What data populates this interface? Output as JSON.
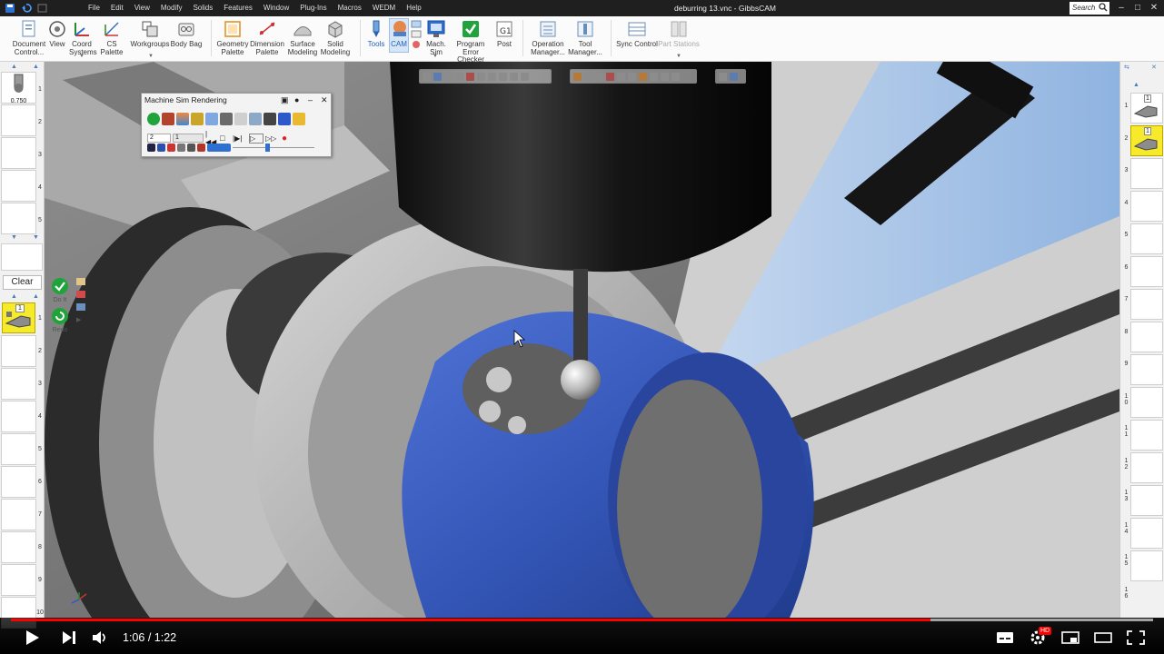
{
  "window": {
    "title": "deburring 13.vnc - GibbsCAM",
    "menus": [
      "File",
      "Edit",
      "View",
      "Modify",
      "Solids",
      "Features",
      "Window",
      "Plug-Ins",
      "Macros",
      "WEDM",
      "Help"
    ],
    "search_placeholder": "Search"
  },
  "ribbon": {
    "buttons": [
      {
        "label1": "Document",
        "label2": "Control..."
      },
      {
        "label1": "View",
        "label2": ""
      },
      {
        "label1": "Coord",
        "label2": "Systems"
      },
      {
        "label1": "CS Palette",
        "label2": ""
      },
      {
        "label1": "Workgroups",
        "label2": ""
      },
      {
        "label1": "Body Bag",
        "label2": ""
      },
      {
        "label1": "Geometry",
        "label2": "Palette"
      },
      {
        "label1": "Dimension",
        "label2": "Palette"
      },
      {
        "label1": "Surface",
        "label2": "Modeling"
      },
      {
        "label1": "Solid",
        "label2": "Modeling"
      },
      {
        "label1": "Tools",
        "label2": ""
      },
      {
        "label1": "CAM",
        "label2": ""
      },
      {
        "label1": "Mach.",
        "label2": "Sim"
      },
      {
        "label1": "Program",
        "label2": "Error Checker"
      },
      {
        "label1": "Post",
        "label2": ""
      },
      {
        "label1": "Operation",
        "label2": "Manager..."
      },
      {
        "label1": "Tool",
        "label2": "Manager..."
      },
      {
        "label1": "Sync Control",
        "label2": ""
      },
      {
        "label1": "Part Stations",
        "label2": ""
      }
    ]
  },
  "sim_panel": {
    "title": "Machine Sim Rendering",
    "step_value": "2",
    "frame_value": "1"
  },
  "left_panel": {
    "tool_diameter": "0.750",
    "tab_numbers": [
      "1",
      "2",
      "3",
      "4",
      "5"
    ],
    "clear_label": "Clear",
    "do_it_label": "Do It",
    "redo_label": "Redo",
    "ops_numbers": [
      "1",
      "2",
      "3",
      "4",
      "5",
      "6",
      "7",
      "8",
      "9",
      "10"
    ],
    "op_tool_number": "1"
  },
  "right_panel": {
    "tool_numbers": [
      "1",
      "2",
      "3",
      "4",
      "5",
      "6",
      "7",
      "8",
      "9",
      "10",
      "11",
      "12",
      "13",
      "14",
      "15",
      "16"
    ],
    "tile1_tool": "1",
    "tile2_tool": "1"
  },
  "video": {
    "current_time": "1:06",
    "separator": " / ",
    "duration": "1:22",
    "progress": 0.805,
    "buffered": 1.0,
    "hd_badge": "HD"
  },
  "colors": {
    "part_blue": "#3557b8",
    "tool_tile_yellow": "#f6ea2b",
    "progress_red": "#ff0000",
    "check_green": "#1fa33a"
  }
}
